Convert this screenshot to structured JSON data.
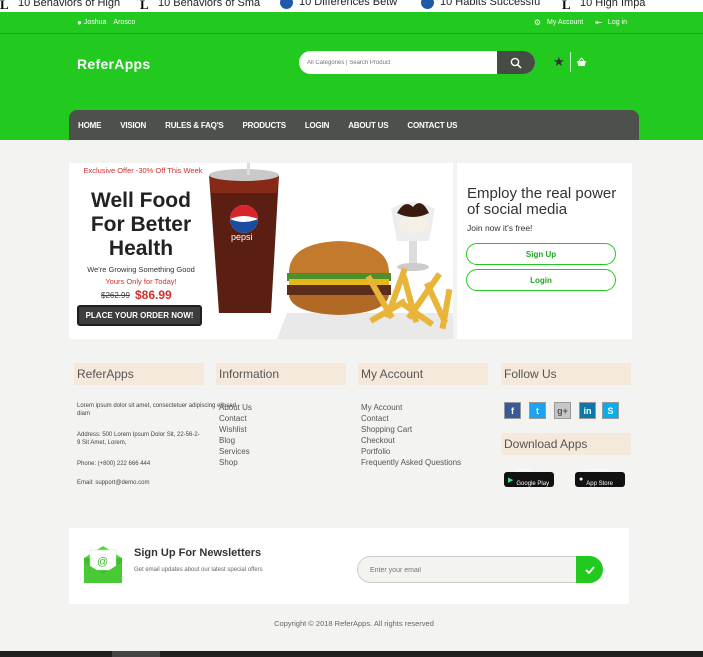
{
  "browser_tabs": [
    {
      "icon": "letter-l-icon",
      "label": "10 Behaviors of High"
    },
    {
      "icon": "letter-l-icon",
      "label": "10 Behaviors of Sma"
    },
    {
      "icon": "blue-circle-icon",
      "label": "10 Differences Betw"
    },
    {
      "icon": "blue-circle-icon",
      "label": "10 Habits Successfu"
    },
    {
      "icon": "letter-l-icon",
      "label": "10 High Impa"
    }
  ],
  "topbar": {
    "first_name": "Joshua",
    "last_name": "Arosco",
    "my_account": "My Account",
    "login": "Log in"
  },
  "header": {
    "logo": "ReferApps",
    "search_placeholder": "All Categories | Search Product"
  },
  "nav": [
    "HOME",
    "VISION",
    "RULES & FAQ'S",
    "PRODUCTS",
    "LOGIN",
    "ABOUT US",
    "CONTACT US"
  ],
  "banner": {
    "offer": "Exclusive Offer -30% Off This Week",
    "headline": "Well Food For Better Health",
    "growing": "We're Growing Something Good",
    "today": "Yours Only for Today!",
    "old_price": "$262.99",
    "new_price": "$86.99",
    "cta": "PLACE YOUR ORDER NOW!",
    "cup_brand": "pepsi"
  },
  "social_card": {
    "title": "Employ the real power of social media",
    "join": "Join now it's free!",
    "signup": "Sign Up",
    "login": "Login"
  },
  "footer": {
    "about": {
      "title": "ReferApps",
      "desc": "Lorem ipsum dolor sit amet, consectetuer adipiscing elit sed diam",
      "address": "Address: 500 Lorem Ipsum Dolor Sit, 22-56-2-9 Sit Amet, Lorem,",
      "phone": "Phone: (+800) 222 666 444",
      "email": "Email: support@demo.com"
    },
    "information": {
      "title": "Information",
      "links": [
        "About Us",
        "Contact",
        "Wishlist",
        "Blog",
        "Services",
        "Shop"
      ]
    },
    "account": {
      "title": "My Account",
      "links": [
        "My Account",
        "Contact",
        "Shopping Cart",
        "Checkout",
        "Portfolio",
        "Frequently Asked Questions"
      ]
    },
    "follow": {
      "title": "Follow Us",
      "icons": [
        {
          "name": "facebook-icon",
          "glyph": "f",
          "color": "#3b5998"
        },
        {
          "name": "twitter-icon",
          "glyph": "t",
          "color": "#1da1f2"
        },
        {
          "name": "google-plus-icon",
          "glyph": "g+",
          "color": "#c7c7c7"
        },
        {
          "name": "linkedin-icon",
          "glyph": "in",
          "color": "#0e76a8"
        },
        {
          "name": "skype-icon",
          "glyph": "S",
          "color": "#00aff0"
        }
      ]
    },
    "download": {
      "title": "Download Apps",
      "google_play_top": "GET IT ON",
      "google_play": "Google Play",
      "app_store_top": "Available on the",
      "app_store": "App Store"
    }
  },
  "newsletter": {
    "title": "Sign Up For Newsletters",
    "sub": "Get email updates about our latest special offers",
    "placeholder": "Enter your email"
  },
  "copyright": "Copyright © 2018 ReferApps. All rights reserved",
  "colors": {
    "brand_green": "#22c91f",
    "nav_dark": "#4c524b",
    "price_red": "#d62d2d"
  }
}
